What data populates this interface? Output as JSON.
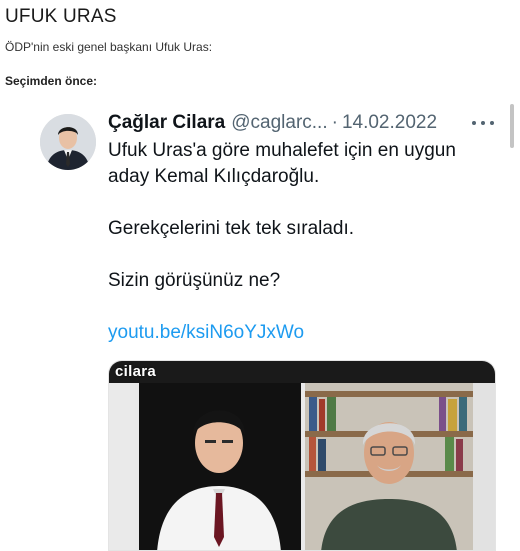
{
  "page": {
    "title": "UFUK URAS",
    "intro": "ÖDP'nin eski genel başkanı Ufuk Uras:",
    "section_label": "Seçimden önce:"
  },
  "tweet": {
    "author_name": "Çağlar Cilara",
    "author_handle": "@caglarc...",
    "separator": "·",
    "date": "14.02.2022",
    "text_line1": "Ufuk Uras'a göre muhalefet için en uygun",
    "text_line2": "aday Kemal Kılıçdaroğlu.",
    "text_line3": "Gerekçelerini tek tek sıraladı.",
    "text_line4": "Sizin görüşünüz ne?",
    "link_text": "youtu.be/ksiN6oYJxWo",
    "media_brand": "cilara"
  },
  "colors": {
    "link": "#1d9bf0",
    "secondary_text": "#536471",
    "primary_text": "#0f1419"
  },
  "icons": {
    "more": "more-horizontal-icon",
    "avatar": "user-avatar"
  }
}
